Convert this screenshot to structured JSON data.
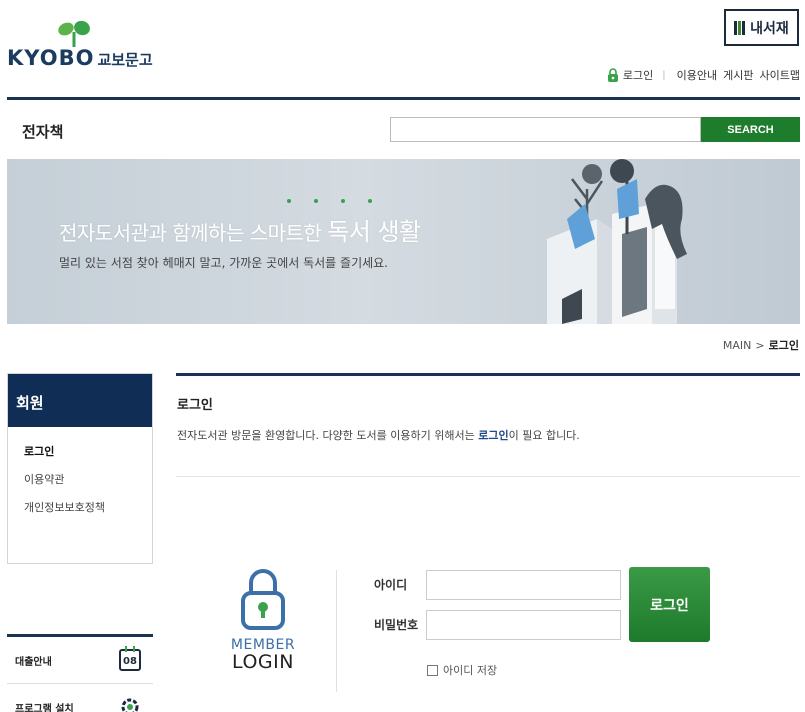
{
  "header": {
    "logo_text": "KYOBO",
    "logo_korean": "교보문고",
    "my_library_label": "내서재",
    "util_nav": [
      {
        "label": "로그인",
        "icon": "lock-icon"
      },
      {
        "label": "이용안내"
      },
      {
        "label": "게시판"
      },
      {
        "label": "사이트맵"
      }
    ]
  },
  "section_title": "전자책",
  "search": {
    "value": "",
    "placeholder": "",
    "button_label": "SEARCH"
  },
  "banner": {
    "headline_part1": "전자도서관과 함께하는 스마트한 ",
    "headline_part2": "독서 생활",
    "subline": "멀리 있는 서점 찾아 헤매지 말고, 가까운 곳에서 독서를 즐기세요."
  },
  "breadcrumb": {
    "root": "MAIN",
    "separator": ">",
    "current": "로그인"
  },
  "sidebar": {
    "heading": "회원",
    "items": [
      {
        "label": "로그인",
        "active": true
      },
      {
        "label": "이용약관",
        "active": false
      },
      {
        "label": "개인정보보호정책",
        "active": false
      }
    ],
    "quick_links": [
      {
        "label": "대출안내",
        "icon": "calendar-icon",
        "icon_text": "08"
      },
      {
        "label": "프로그램 설치",
        "icon": "gear-icon"
      }
    ]
  },
  "content": {
    "title": "로그인",
    "desc_before": "전자도서관 방문을 환영합니다. 다양한 도서를 이용하기 위해서는 ",
    "desc_highlight": "로그인",
    "desc_after": "이 필요 합니다."
  },
  "login_form": {
    "member_text_top": "MEMBER",
    "member_text_bottom": "LOGIN",
    "id_label": "아이디",
    "id_value": "",
    "password_label": "비밀번호",
    "password_value": "",
    "submit_label": "로그인",
    "remember_label": "아이디 저장",
    "remember_checked": false
  },
  "colors": {
    "navy": "#0f2d55",
    "green": "#1e7d2c",
    "member_blue": "#3d6fa8"
  }
}
